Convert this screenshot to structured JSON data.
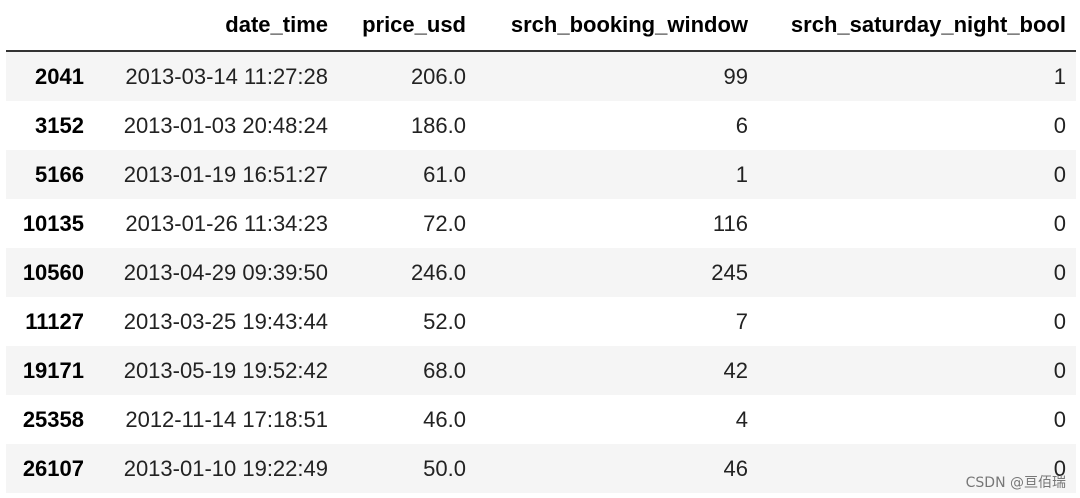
{
  "table": {
    "columns": [
      "",
      "date_time",
      "price_usd",
      "srch_booking_window",
      "srch_saturday_night_bool"
    ],
    "rows": [
      {
        "index": "2041",
        "date_time": "2013-03-14 11:27:28",
        "price_usd": "206.0",
        "srch_booking_window": "99",
        "srch_saturday_night_bool": "1"
      },
      {
        "index": "3152",
        "date_time": "2013-01-03 20:48:24",
        "price_usd": "186.0",
        "srch_booking_window": "6",
        "srch_saturday_night_bool": "0"
      },
      {
        "index": "5166",
        "date_time": "2013-01-19 16:51:27",
        "price_usd": "61.0",
        "srch_booking_window": "1",
        "srch_saturday_night_bool": "0"
      },
      {
        "index": "10135",
        "date_time": "2013-01-26 11:34:23",
        "price_usd": "72.0",
        "srch_booking_window": "116",
        "srch_saturday_night_bool": "0"
      },
      {
        "index": "10560",
        "date_time": "2013-04-29 09:39:50",
        "price_usd": "246.0",
        "srch_booking_window": "245",
        "srch_saturday_night_bool": "0"
      },
      {
        "index": "11127",
        "date_time": "2013-03-25 19:43:44",
        "price_usd": "52.0",
        "srch_booking_window": "7",
        "srch_saturday_night_bool": "0"
      },
      {
        "index": "19171",
        "date_time": "2013-05-19 19:52:42",
        "price_usd": "68.0",
        "srch_booking_window": "42",
        "srch_saturday_night_bool": "0"
      },
      {
        "index": "25358",
        "date_time": "2012-11-14 17:18:51",
        "price_usd": "46.0",
        "srch_booking_window": "4",
        "srch_saturday_night_bool": "0"
      },
      {
        "index": "26107",
        "date_time": "2013-01-10 19:22:49",
        "price_usd": "50.0",
        "srch_booking_window": "46",
        "srch_saturday_night_bool": "0"
      }
    ]
  },
  "watermark": "CSDN @亘佰瑞"
}
